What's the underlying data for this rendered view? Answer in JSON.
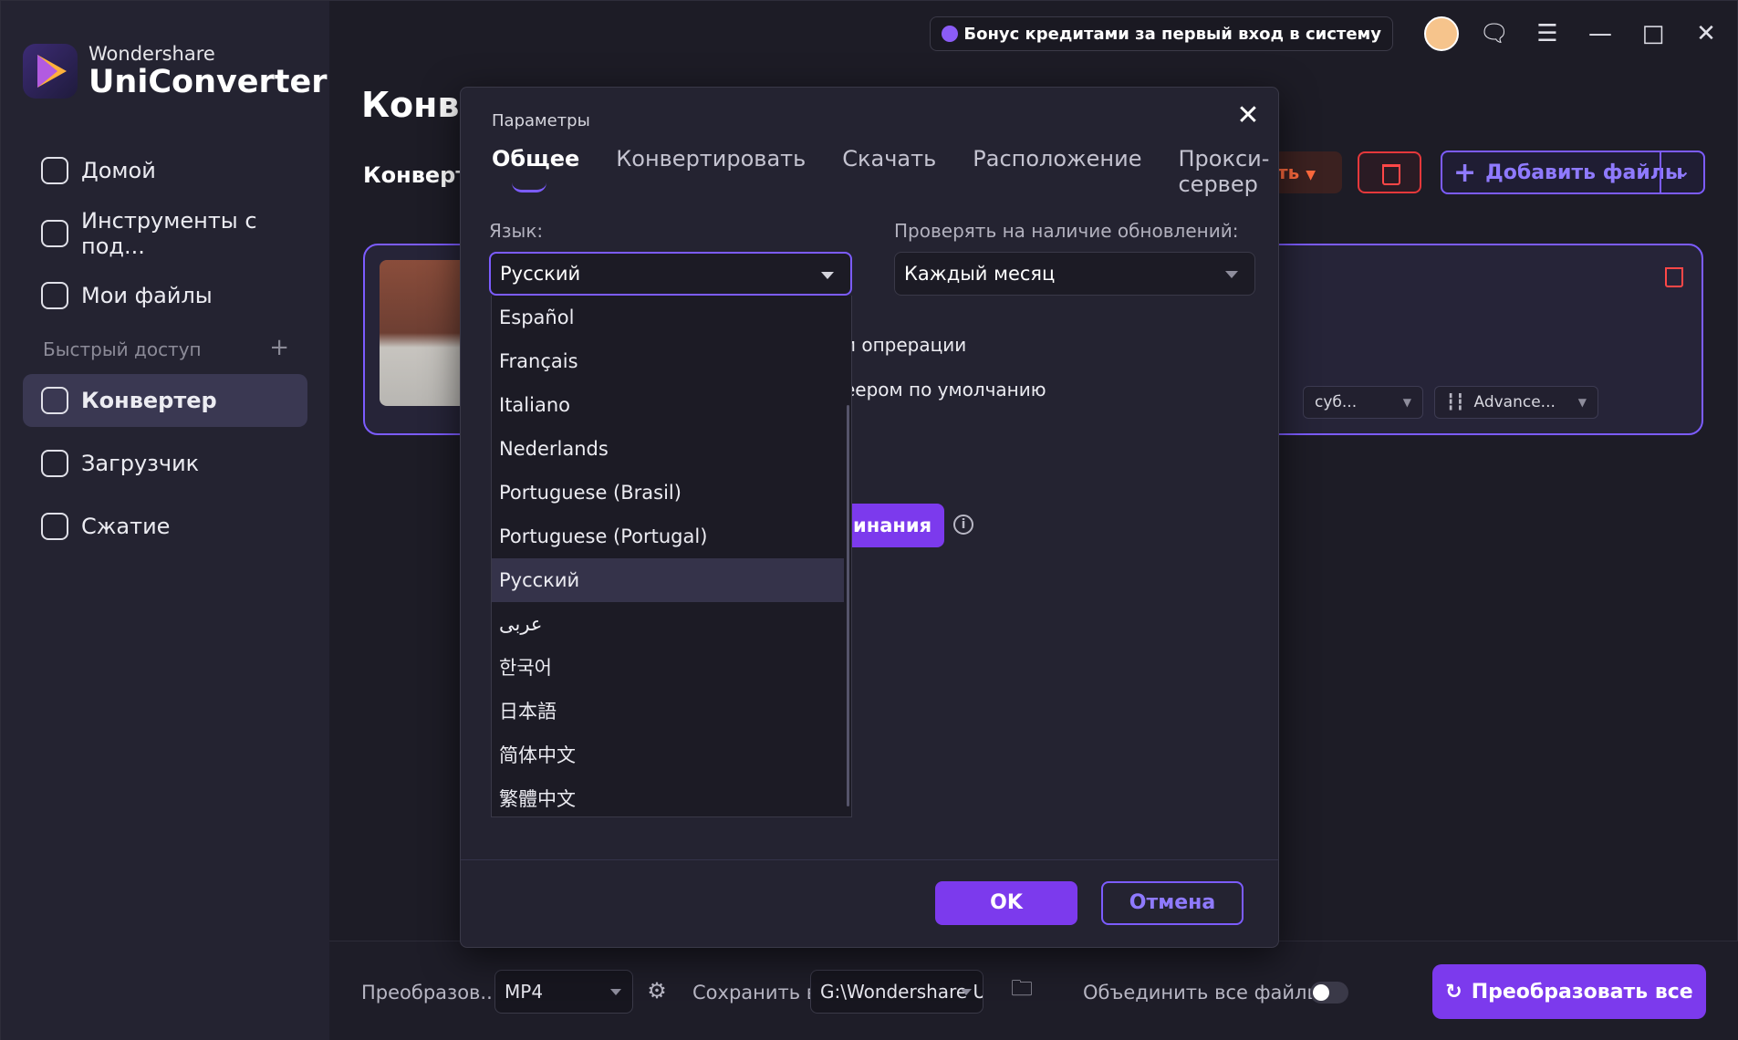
{
  "app": {
    "brand": "Wondershare",
    "name": "UniConverter"
  },
  "sidebar": {
    "items": [
      {
        "label": "Домой",
        "icon": "home-icon"
      },
      {
        "label": "Инструменты с под...",
        "icon": "toolbox-icon"
      },
      {
        "label": "Мои файлы",
        "icon": "files-icon"
      },
      {
        "label": "Конвертер",
        "icon": "converter-icon"
      },
      {
        "label": "Загрузчик",
        "icon": "download-icon"
      },
      {
        "label": "Сжатие",
        "icon": "compress-icon"
      }
    ],
    "quick_access": "Быстрый доступ",
    "quick_add": "+"
  },
  "topbar": {
    "bonus": "Бонус кредитами за первый вход в систему"
  },
  "main": {
    "title": "Конве",
    "subtab": "Конверт",
    "orange_btn": "ть",
    "add_files": "Добавить файлы"
  },
  "card": {
    "subtitle_select": "суб...",
    "audio_select": "Advance..."
  },
  "bottom": {
    "format_label": "Преобразов...",
    "format_value": "MP4",
    "save_label": "Сохранить в",
    "save_value": "G:\\Wondershare Ur",
    "merge_label": "Объединить все файлы",
    "convert_all": "Преобразовать все"
  },
  "dialog": {
    "title": "Параметры",
    "tabs": [
      "Общее",
      "Конвертировать",
      "Скачать",
      "Расположение",
      "Прокси-сервер"
    ],
    "language_label": "Язык:",
    "language_value": "Русский",
    "updates_label": "Проверять на наличие обновлений:",
    "updates_value": "Каждый месяц",
    "line1": "и опрерации",
    "line2": "еером по умолчанию",
    "purple_btn": "инания",
    "info": "i",
    "ok": "OK",
    "cancel": "Отмена",
    "languages": [
      "Español",
      "Français",
      "Italiano",
      "Nederlands",
      "Portuguese (Brasil)",
      "Portuguese (Portugal)",
      "Русский",
      "عربى",
      "한국어",
      "日本語",
      "简体中文",
      "繁體中文"
    ],
    "selected_language_index": 6
  },
  "colors": {
    "accent": "#7c3aed",
    "accent_border": "#7c5cff",
    "danger": "#ff4747"
  }
}
